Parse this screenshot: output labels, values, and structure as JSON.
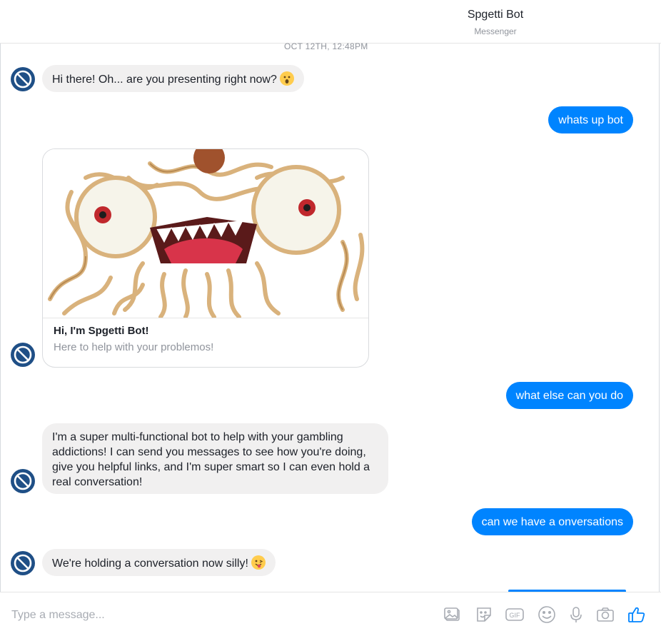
{
  "header": {
    "title": "Spgetti Bot",
    "subtitle": "Messenger"
  },
  "timestamp": "OCT 12TH, 12:48PM",
  "messages": {
    "m1": "Hi there! Oh... are you presenting right now?",
    "m2": "whats up bot",
    "card_title": "Hi, I'm Spgetti Bot!",
    "card_subtitle": "Here to help with your problemos!",
    "m3": "what else can you do",
    "m4": "I'm a super multi-functional bot to help with your gambling addictions!  I can send you messages to see how you're doing, give you helpful links, and I'm super smart so I can even hold a real conversation!",
    "m5": "can we have a onversations",
    "m6": "We're holding a conversation now silly!"
  },
  "composer": {
    "placeholder": "Type a message..."
  },
  "icons": [
    "image-icon",
    "sticker-icon",
    "gif-icon",
    "emoji-icon",
    "microphone-icon",
    "camera-icon",
    "thumbs-up-icon"
  ],
  "colors": {
    "accent": "#0084ff",
    "bot_bubble": "#f1f0f0",
    "avatar": "#1f4f86"
  }
}
